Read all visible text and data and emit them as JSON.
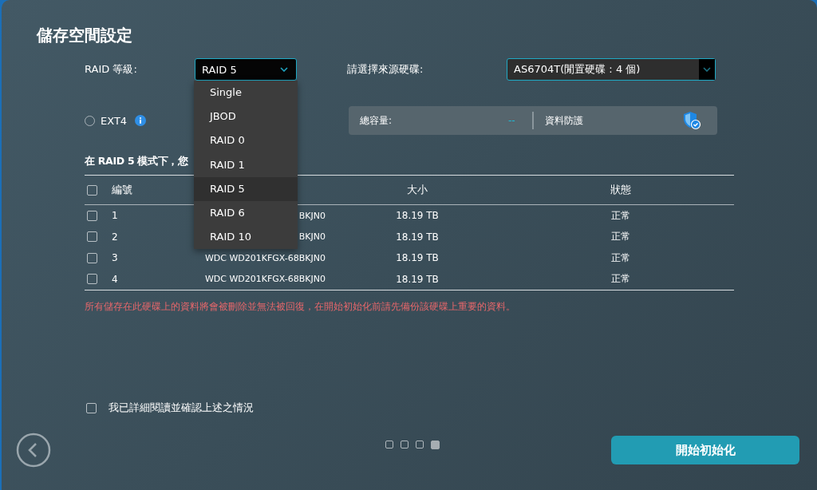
{
  "title": "儲存空間設定",
  "raid_level": {
    "label": "RAID 等級:",
    "value": "RAID 5",
    "expanded": true,
    "options": [
      {
        "label": "Single",
        "selected": false
      },
      {
        "label": "JBOD",
        "selected": false
      },
      {
        "label": "RAID 0",
        "selected": false
      },
      {
        "label": "RAID 1",
        "selected": false
      },
      {
        "label": "RAID 5",
        "selected": true
      },
      {
        "label": "RAID 6",
        "selected": false
      },
      {
        "label": "RAID 10",
        "selected": false
      }
    ]
  },
  "source_disk": {
    "label": "請選擇來源硬碟:",
    "value": "AS6704T(閒置硬碟 : 4 個)"
  },
  "filesystems": [
    {
      "label": "EXT4",
      "selected": false
    }
  ],
  "summary": {
    "capacity_label": "總容量:",
    "capacity_value": "--",
    "protection_label": "資料防護"
  },
  "heading": "在 RAID 5 模式下，您",
  "table": {
    "columns": [
      "編號",
      "大小",
      "狀態"
    ],
    "all_checked": false,
    "rows": [
      {
        "checked": false,
        "number": "1",
        "model": "BKJN0",
        "size": "18.19 TB",
        "status": "正常"
      },
      {
        "checked": false,
        "number": "2",
        "model": "BKJN0",
        "size": "18.19 TB",
        "status": "正常"
      },
      {
        "checked": false,
        "number": "3",
        "model": "WDC WD201KFGX-68BKJN0",
        "size": "18.19 TB",
        "status": "正常"
      },
      {
        "checked": false,
        "number": "4",
        "model": "WDC WD201KFGX-68BKJN0",
        "size": "18.19 TB",
        "status": "正常"
      }
    ]
  },
  "warning": "所有儲存在此硬碟上的資料將會被刪除並無法被回復，在開始初始化前請先備份該硬碟上重要的資料。",
  "confirm": {
    "label": "我已詳細閱讀並確認上述之情況",
    "checked": false
  },
  "pager": [
    {
      "selected": false
    },
    {
      "selected": false
    },
    {
      "selected": false
    },
    {
      "selected": true
    }
  ],
  "start_button": "開始初始化"
}
